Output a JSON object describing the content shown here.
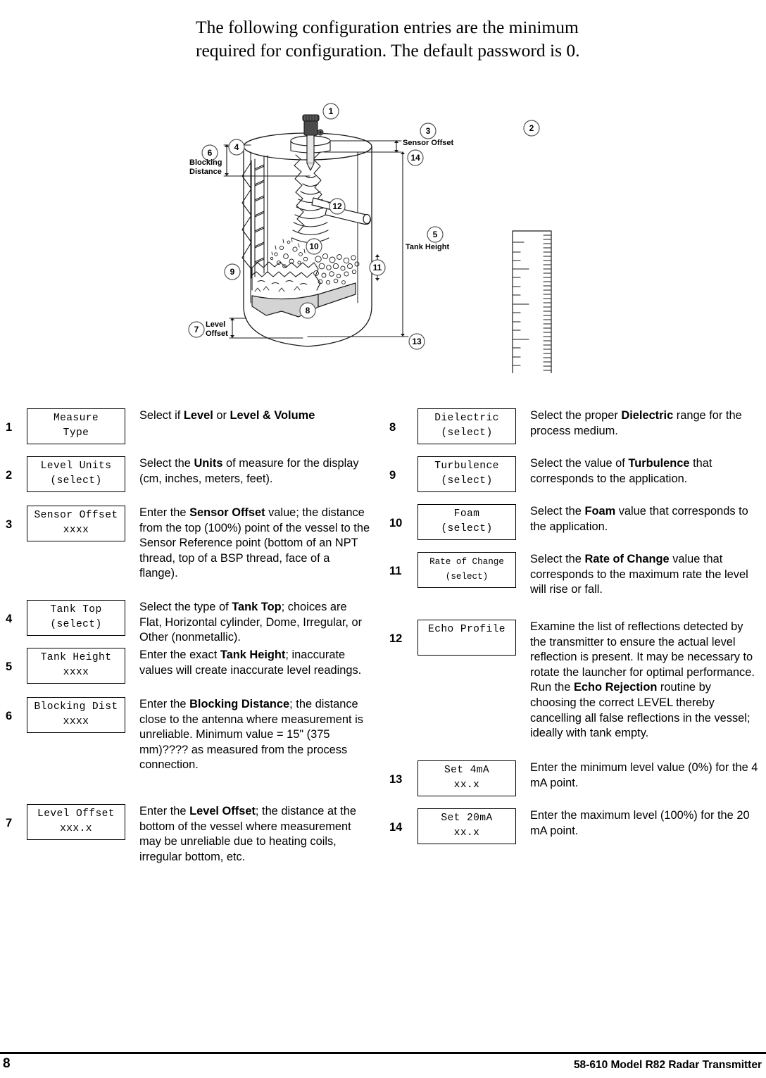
{
  "intro": {
    "line1": "The following configuration entries are the minimum",
    "line2": "required for configuration. The default password is 0."
  },
  "diagram": {
    "labels": {
      "sensor_offset": "Sensor Offset",
      "blocking_distance_1": "Blocking",
      "blocking_distance_2": "Distance",
      "tank_height": "Tank Height",
      "level_offset_1": "Level",
      "level_offset_2": "Offset"
    },
    "callouts": [
      "1",
      "2",
      "3",
      "4",
      "5",
      "6",
      "7",
      "8",
      "9",
      "10",
      "11",
      "12",
      "13",
      "14"
    ],
    "colors": {
      "line": "#1a1a1a",
      "sediment_fill": "#d4d4d4",
      "sensor_cap": "#4a4a4a",
      "probe_fill": "#e8e8e8"
    }
  },
  "config": {
    "left": [
      {
        "num": "1",
        "lcd_line1": "Measure",
        "lcd_line2": "Type",
        "desc_html": "Select if <b>Level</b> or <b>Level &amp; Volume</b>"
      },
      {
        "num": "2",
        "lcd_line1": "Level Units",
        "lcd_line2": "(select)",
        "desc_html": "Select the <b>Units</b> of measure for the display (cm, inches, meters, feet)."
      },
      {
        "num": "3",
        "lcd_line1": "Sensor Offset",
        "lcd_line2": "xxxx",
        "desc_html": "Enter the <b>Sensor Offset</b> value; the distance from the top (100%) point of the vessel to the Sensor Reference point (bottom of an NPT thread, top of a BSP thread, face of a flange)."
      },
      {
        "num": "4",
        "lcd_line1": "Tank Top",
        "lcd_line2": "(select)",
        "desc_html": "Select the type of <b>Tank Top</b>; choices are Flat, Horizontal cylinder, Dome, Irregular, or Other (nonmetallic)."
      },
      {
        "num": "5",
        "lcd_line1": "Tank Height",
        "lcd_line2": "xxxx",
        "desc_html": "Enter the exact <b>Tank Height</b>; inaccurate values will create inaccurate level readings."
      },
      {
        "num": "6",
        "lcd_line1": "Blocking Dist",
        "lcd_line2": "xxxx",
        "desc_html": "Enter the <b>Blocking Distance</b>; the distance close to the antenna where measurement is unreliable.  Minimum value = 15\" (375 mm)???? as measured from the process connection."
      },
      {
        "num": "7",
        "lcd_line1": "Level Offset",
        "lcd_line2": "xxx.x",
        "desc_html": "Enter the <b>Level Offset</b>; the distance at the bottom of the vessel where measurement may be unreliable due to heating coils, irregular bottom, etc."
      }
    ],
    "right": [
      {
        "num": "8",
        "lcd_line1": "Dielectric",
        "lcd_line2": "(select)",
        "desc_html": "Select the proper <b>Dielectric</b> range for the process medium."
      },
      {
        "num": "9",
        "lcd_line1": "Turbulence",
        "lcd_line2": "(select)",
        "desc_html": "Select the value of <b>Turbulence</b> that corresponds to the application."
      },
      {
        "num": "10",
        "lcd_line1": "Foam",
        "lcd_line2": "(select)",
        "desc_html": "Select the <b>Foam</b> value that corresponds to the application."
      },
      {
        "num": "11",
        "lcd_line1": "Rate of Change",
        "lcd_line2": "(select)",
        "desc_html": "Select the <b>Rate of Change</b> value that corresponds to the maximum rate the level will rise or fall."
      },
      {
        "num": "12",
        "lcd_line1": "Echo Profile",
        "lcd_line2": "",
        "desc_html": "Examine the list of reflections detected by the transmitter to ensure the actual level reflection is present. It may be necessary to rotate the launcher for optimal performance. Run the <b>Echo Rejection</b> routine by choosing the correct LEVEL thereby cancelling all false reflections in the vessel; ideally with tank empty."
      },
      {
        "num": "13",
        "lcd_line1": "Set 4mA",
        "lcd_line2": "xx.x",
        "desc_html": "Enter the minimum level value (0%) for the 4 mA point."
      },
      {
        "num": "14",
        "lcd_line1": "Set 20mA",
        "lcd_line2": "xx.x",
        "desc_html": "Enter the maximum level (100%) for the 20 mA point."
      }
    ]
  },
  "footer": {
    "page_number": "8",
    "document_title": "58-610 Model R82 Radar Transmitter"
  }
}
